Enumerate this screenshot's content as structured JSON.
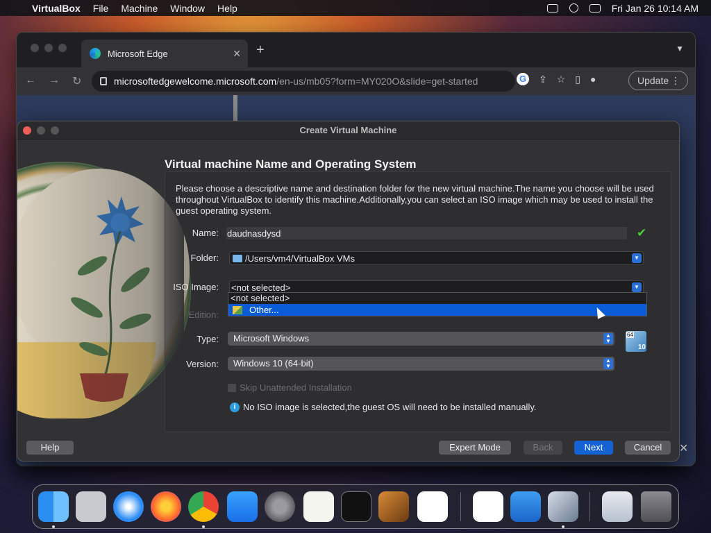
{
  "menubar": {
    "app_name": "VirtualBox",
    "menus": [
      "File",
      "Machine",
      "Window",
      "Help"
    ],
    "datetime": "Fri Jan 26  10:14 AM"
  },
  "browser": {
    "tab_title": "Microsoft Edge",
    "url_host": "microsoftedgewelcome.microsoft.com",
    "url_path": "/en-us/mb05?form=MY020O&slide=get-started",
    "update_label": "Update"
  },
  "dialog": {
    "title": "Create Virtual Machine",
    "heading": "Virtual machine Name and Operating System",
    "description": "Please choose a descriptive name and destination folder for the new virtual machine.The name you choose will be used throughout VirtualBox to identify this machine.Additionally,you can select an ISO image which may be used to install the guest operating system.",
    "name_label": "Name:",
    "name_value": "daudnasdysd",
    "folder_label": "Folder:",
    "folder_value": "/Users/vm4/VirtualBox VMs",
    "iso_label": "ISO Image:",
    "iso_value": "<not selected>",
    "iso_options": [
      "<not selected>",
      "Other..."
    ],
    "edition_label": "Edition:",
    "type_label": "Type:",
    "type_value": "Microsoft Windows",
    "version_label": "Version:",
    "version_value": "Windows 10 (64-bit)",
    "os_badge_64": "64",
    "os_badge_10": "10",
    "skip_label": "Skip Unattended Installation",
    "info_text": "No ISO image is selected,the guest OS will need to be installed manually.",
    "buttons": {
      "help": "Help",
      "expert": "Expert Mode",
      "back": "Back",
      "next": "Next",
      "cancel": "Cancel"
    }
  },
  "dock": {
    "apps": [
      "finder-icon",
      "launchpad-icon",
      "safari-icon",
      "firefox-icon",
      "chrome-icon",
      "app-store-icon",
      "system-settings-icon",
      "textedit-icon",
      "terminal-icon",
      "garageband-icon",
      "vscode-icon",
      "visual-studio-icon",
      "icloud-icon",
      "virtualbox-icon",
      "vm-preview-icon",
      "trash-icon"
    ]
  }
}
